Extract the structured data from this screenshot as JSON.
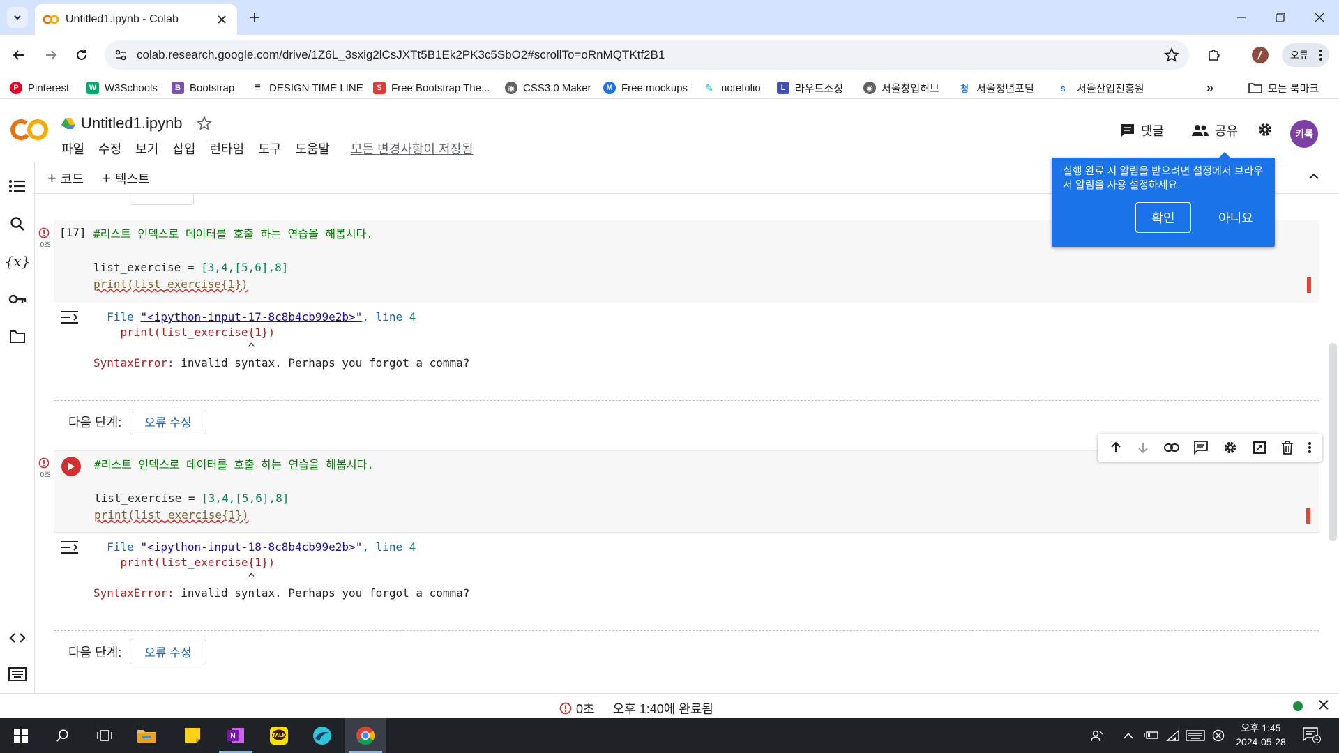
{
  "browser": {
    "tab_title": "Untitled1.ipynb - Colab",
    "url": "colab.research.google.com/drive/1Z6L_3sxig2lCsJXTt5B1Ek2PK3c5SbO2#scrollTo=oRnMQTKtf2B1",
    "profile_label": "오류",
    "bookmarks": [
      {
        "label": "Pinterest",
        "color": "#e60023",
        "glyph": "P"
      },
      {
        "label": "W3Schools",
        "color": "#04aa6d",
        "glyph": "W"
      },
      {
        "label": "Bootstrap",
        "color": "#7952b3",
        "glyph": "B"
      },
      {
        "label": "DESIGN TIME LINE",
        "color": "#202124",
        "glyph": "≡"
      },
      {
        "label": "Free Bootstrap The...",
        "color": "#e53935",
        "glyph": "S"
      },
      {
        "label": "CSS3.0 Maker",
        "color": "#5f6368",
        "glyph": "◉"
      },
      {
        "label": "Free mockups",
        "color": "#1a73e8",
        "glyph": "M"
      },
      {
        "label": "notefolio",
        "color": "#00bcd4",
        "glyph": "✎"
      },
      {
        "label": "라우드소싱",
        "color": "#3f51b5",
        "glyph": "L"
      },
      {
        "label": "서울창업허브",
        "color": "#5f6368",
        "glyph": "◉"
      },
      {
        "label": "서울청년포털",
        "color": "#1a73e8",
        "glyph": "청"
      },
      {
        "label": "서울산업진흥원",
        "color": "#1a73e8",
        "glyph": "s"
      }
    ],
    "all_bookmarks": "모든 북마크"
  },
  "colab": {
    "notebook_title": "Untitled1.ipynb",
    "menu": [
      "파일",
      "수정",
      "보기",
      "삽입",
      "런타임",
      "도구",
      "도움말"
    ],
    "saved_status": "모든 변경사항이 저장됨",
    "comments_label": "댓글",
    "share_label": "공유",
    "avatar_label": "키록",
    "add_code": "코드",
    "add_text": "텍스트"
  },
  "popup": {
    "message": "실행 완료 시 알림을 받으려면 설정에서 브라우저 알림을 사용 설정하세요.",
    "confirm": "확인",
    "decline": "아니요"
  },
  "cells": [
    {
      "exec_count": "[17]",
      "time": "0초",
      "comment": "#리스트 인덱스로 데이터를 호출 하는 연습을 해봅시다.",
      "line2_name": "list_exercise",
      "line2_op": " = ",
      "line2_value": "[3,4,[5,6],8]",
      "line3": "print(list_exercise{1})",
      "out_file_prefix": "File ",
      "out_file_link": "\"<ipython-input-17-8c8b4cb99e2b>\"",
      "out_line_label": ", line ",
      "out_line_num": "4",
      "out_code": "print(list_exercise{1})",
      "out_caret": "^",
      "error_name": "SyntaxError:",
      "error_msg": " invalid syntax. Perhaps you forgot a comma?"
    },
    {
      "exec_count": "",
      "time": "0초",
      "comment": "#리스트 인덱스로 데이터를 호출 하는 연습을 해봅시다.",
      "line2_name": "list_exercise",
      "line2_op": " = ",
      "line2_value": "[3,4,[5,6],8]",
      "line3": "print(list_exercise{1})",
      "out_file_prefix": "File ",
      "out_file_link": "\"<ipython-input-18-8c8b4cb99e2b>\"",
      "out_line_label": ", line ",
      "out_line_num": "4",
      "out_code": "print(list_exercise{1})",
      "out_caret": "^",
      "error_name": "SyntaxError:",
      "error_msg": " invalid syntax. Perhaps you forgot a comma?"
    }
  ],
  "next_step": {
    "label": "다음 단계:",
    "button": "오류 수정"
  },
  "statusbar": {
    "duration": "0초",
    "completed": "오후 1:40에 완료됨"
  },
  "taskbar": {
    "time": "오후 1:45",
    "date": "2024-05-28",
    "notification_count": "1"
  }
}
